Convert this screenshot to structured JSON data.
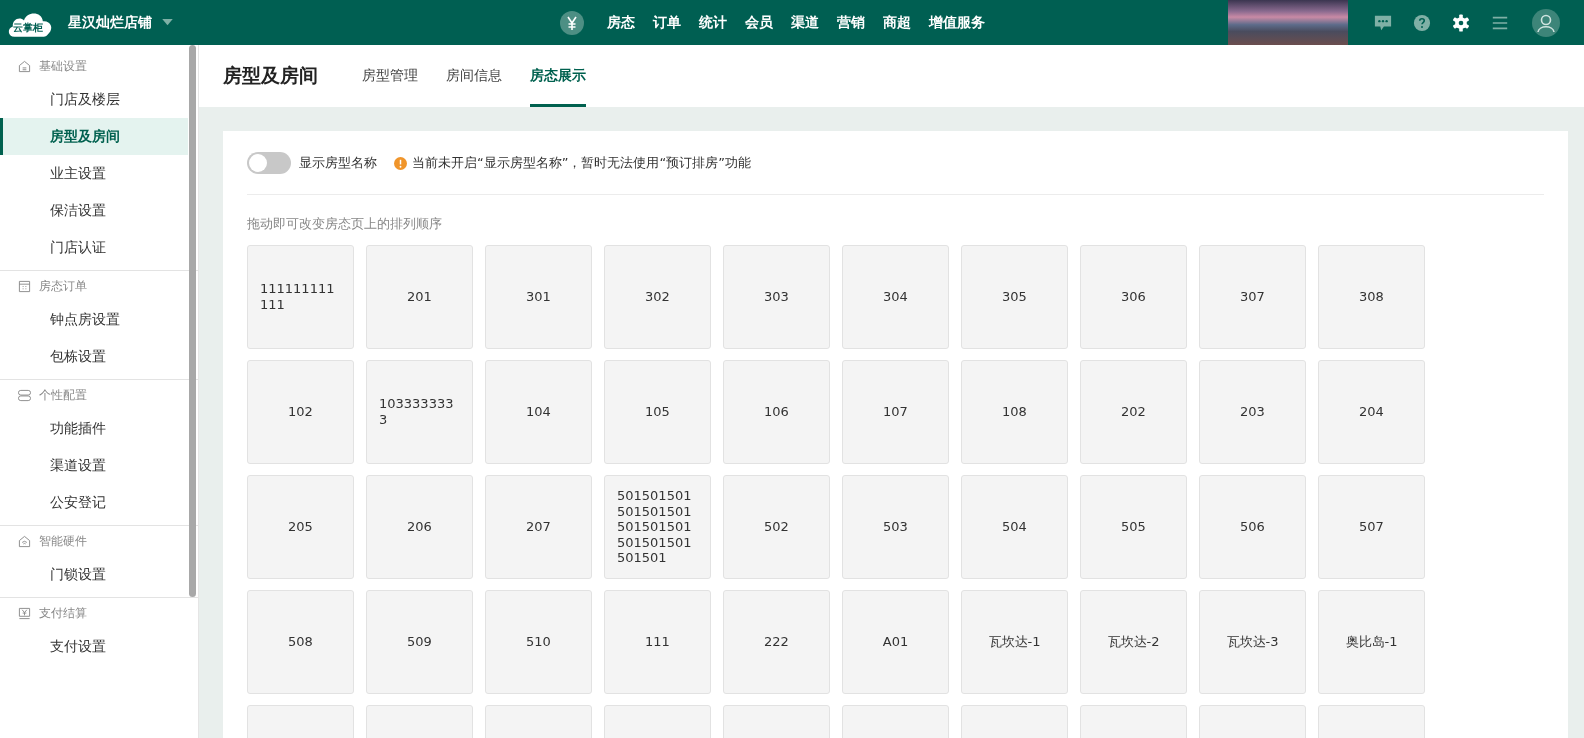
{
  "topbar": {
    "logo": "云掌柜",
    "store": "星汉灿烂店铺",
    "nav": [
      {
        "label": "房态",
        "selected": false
      },
      {
        "label": "订单",
        "selected": false
      },
      {
        "label": "统计",
        "selected": false
      },
      {
        "label": "会员",
        "selected": false
      },
      {
        "label": "渠道",
        "selected": false
      },
      {
        "label": "营销",
        "selected": false
      },
      {
        "label": "商超",
        "selected": false
      },
      {
        "label": "增值服务",
        "selected": false
      }
    ]
  },
  "sidebar": {
    "groups": [
      {
        "title": "基础设置",
        "items": [
          {
            "label": "门店及楼层",
            "selected": false
          },
          {
            "label": "房型及房间",
            "selected": true
          },
          {
            "label": "业主设置",
            "selected": false
          },
          {
            "label": "保洁设置",
            "selected": false
          },
          {
            "label": "门店认证",
            "selected": false
          }
        ]
      },
      {
        "title": "房态订单",
        "items": [
          {
            "label": "钟点房设置",
            "selected": false
          },
          {
            "label": "包栋设置",
            "selected": false
          }
        ]
      },
      {
        "title": "个性配置",
        "items": [
          {
            "label": "功能插件",
            "selected": false
          },
          {
            "label": "渠道设置",
            "selected": false
          },
          {
            "label": "公安登记",
            "selected": false
          }
        ]
      },
      {
        "title": "智能硬件",
        "items": [
          {
            "label": "门锁设置",
            "selected": false
          }
        ]
      },
      {
        "title": "支付结算",
        "items": [
          {
            "label": "支付设置",
            "selected": false
          }
        ]
      }
    ]
  },
  "page": {
    "title": "房型及房间",
    "tabs": [
      {
        "label": "房型管理",
        "selected": false
      },
      {
        "label": "房间信息",
        "selected": false
      },
      {
        "label": "房态展示",
        "selected": true
      }
    ]
  },
  "settings": {
    "toggle": {
      "label": "显示房型名称",
      "on": false
    },
    "warning": "当前未开启“显示房型名称”，暂时无法使用“预订排房”功能",
    "hint": "拖动即可改变房态页上的排列顺序"
  },
  "rooms": [
    [
      "111111111111",
      "201",
      "301",
      "302",
      "303",
      "304",
      "305",
      "306",
      "307",
      "308"
    ],
    [
      "102",
      "1033333333",
      "104",
      "105",
      "106",
      "107",
      "108",
      "202",
      "203",
      "204"
    ],
    [
      "205",
      "206",
      "207",
      "501501501501501501501501501501501501501501",
      "502",
      "503",
      "504",
      "505",
      "506",
      "507"
    ],
    [
      "508",
      "509",
      "510",
      "111",
      "222",
      "A01",
      "瓦坎达-1",
      "瓦坎达-2",
      "瓦坎达-3",
      "奥比岛-1"
    ]
  ]
}
